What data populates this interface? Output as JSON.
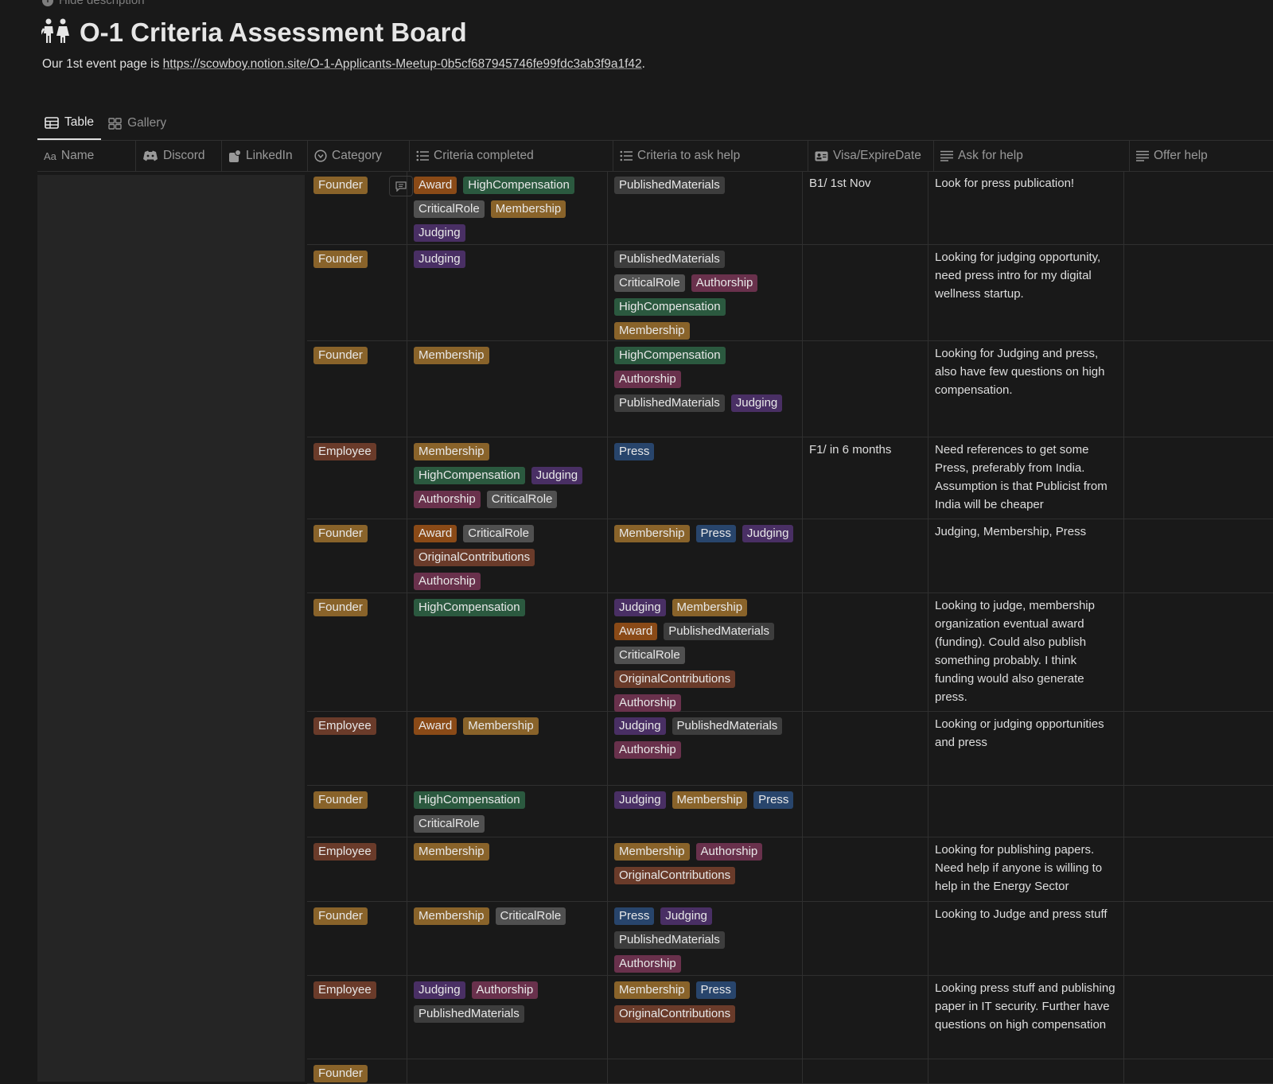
{
  "page": {
    "hide_description": "Hide description",
    "title": "O-1 Criteria Assessment Board",
    "title_icon": "people-icon",
    "description_prefix": "Our 1st event page is ",
    "description_link": "https://scowboy.notion.site/O-1-Applicants-Meetup-0b5cf687945746fe99fdc3ab3f9a1f42",
    "description_suffix": "."
  },
  "views": [
    {
      "label": "Table",
      "icon": "table-icon",
      "active": true
    },
    {
      "label": "Gallery",
      "icon": "gallery-icon",
      "active": false
    }
  ],
  "columns": [
    {
      "label": "Name",
      "icon": "text-icon"
    },
    {
      "label": "Discord",
      "icon": "discord-icon"
    },
    {
      "label": "LinkedIn",
      "icon": "file-icon"
    },
    {
      "label": "Category",
      "icon": "select-icon"
    },
    {
      "label": "Criteria completed",
      "icon": "list-icon"
    },
    {
      "label": "Criteria to ask help",
      "icon": "list-icon"
    },
    {
      "label": "Visa/ExpireDate",
      "icon": "id-card-icon"
    },
    {
      "label": "Ask for help",
      "icon": "lines-icon"
    },
    {
      "label": "Offer help",
      "icon": "lines-icon"
    }
  ],
  "tag_colors": {
    "Founder": "#89632a",
    "Employee": "#6a3b2a",
    "Award": "#8a4a17",
    "HighCompensation": "#2b593f",
    "CriticalRole": "#505050",
    "Membership": "#89632a",
    "Judging": "#492f64",
    "PublishedMaterials": "#3d3d3d",
    "Authorship": "#69314c",
    "Press": "#28456c",
    "OriginalContributions": "#6a3b2a"
  },
  "rows": [
    {
      "category": "Founder",
      "completed": [
        "Award",
        "HighCompensation",
        "CriticalRole",
        "Membership",
        "Judging"
      ],
      "ask": [
        "PublishedMaterials"
      ],
      "visa": "B1/ 1st Nov",
      "ask_help": "Look for press publication!",
      "offer": ""
    },
    {
      "category": "Founder",
      "completed": [
        "Judging"
      ],
      "ask": [
        "PublishedMaterials",
        "CriticalRole",
        "Authorship",
        "HighCompensation",
        "Membership"
      ],
      "visa": "",
      "ask_help": "Looking for judging opportunity, need press intro for my digital wellness startup.",
      "offer": ""
    },
    {
      "category": "Founder",
      "completed": [
        "Membership"
      ],
      "ask": [
        "HighCompensation",
        "Authorship",
        "PublishedMaterials",
        "Judging"
      ],
      "visa": "",
      "ask_help": "Looking for Judging and press, also have few questions on high compensation.",
      "offer": ""
    },
    {
      "category": "Employee",
      "completed": [
        "Membership",
        "HighCompensation",
        "Judging",
        "Authorship",
        "CriticalRole"
      ],
      "ask": [
        "Press"
      ],
      "visa": "F1/ in 6 months",
      "ask_help": "Need references to get some Press, preferably from India. Assumption is that Publicist from India will be cheaper",
      "offer": ""
    },
    {
      "category": "Founder",
      "completed": [
        "Award",
        "CriticalRole",
        "OriginalContributions",
        "Authorship"
      ],
      "ask": [
        "Membership",
        "Press",
        "Judging"
      ],
      "visa": "",
      "ask_help": "Judging, Membership, Press",
      "offer": ""
    },
    {
      "category": "Founder",
      "completed": [
        "HighCompensation"
      ],
      "ask": [
        "Judging",
        "Membership",
        "Award",
        "PublishedMaterials",
        "CriticalRole",
        "OriginalContributions",
        "Authorship"
      ],
      "visa": "",
      "ask_help": "Looking to judge, membership organization eventual award (funding). Could also publish something probably. I think funding would also generate press.",
      "offer": ""
    },
    {
      "category": "Employee",
      "completed": [
        "Award",
        "Membership"
      ],
      "ask": [
        "Judging",
        "PublishedMaterials",
        "Authorship"
      ],
      "visa": "",
      "ask_help": "Looking or judging opportunities and press",
      "offer": ""
    },
    {
      "category": "Founder",
      "completed": [
        "HighCompensation",
        "CriticalRole"
      ],
      "ask": [
        "Judging",
        "Membership",
        "Press"
      ],
      "visa": "",
      "ask_help": "",
      "offer": ""
    },
    {
      "category": "Employee",
      "completed": [
        "Membership"
      ],
      "ask": [
        "Membership",
        "Authorship",
        "OriginalContributions"
      ],
      "visa": "",
      "ask_help": "Looking for publishing papers. Need help if anyone is willing to help in the Energy Sector",
      "offer": ""
    },
    {
      "category": "Founder",
      "completed": [
        "Membership",
        "CriticalRole"
      ],
      "ask": [
        "Press",
        "Judging",
        "PublishedMaterials",
        "Authorship"
      ],
      "visa": "",
      "ask_help": "Looking to Judge and press stuff",
      "offer": ""
    },
    {
      "category": "Employee",
      "completed": [
        "Judging",
        "Authorship",
        "PublishedMaterials"
      ],
      "ask": [
        "Membership",
        "Press",
        "OriginalContributions"
      ],
      "visa": "",
      "ask_help": "Looking press stuff and publishing paper in IT security. Further have questions on high compensation",
      "offer": ""
    },
    {
      "category": "Founder",
      "completed": [],
      "ask": [],
      "visa": "",
      "ask_help": "",
      "offer": ""
    }
  ]
}
